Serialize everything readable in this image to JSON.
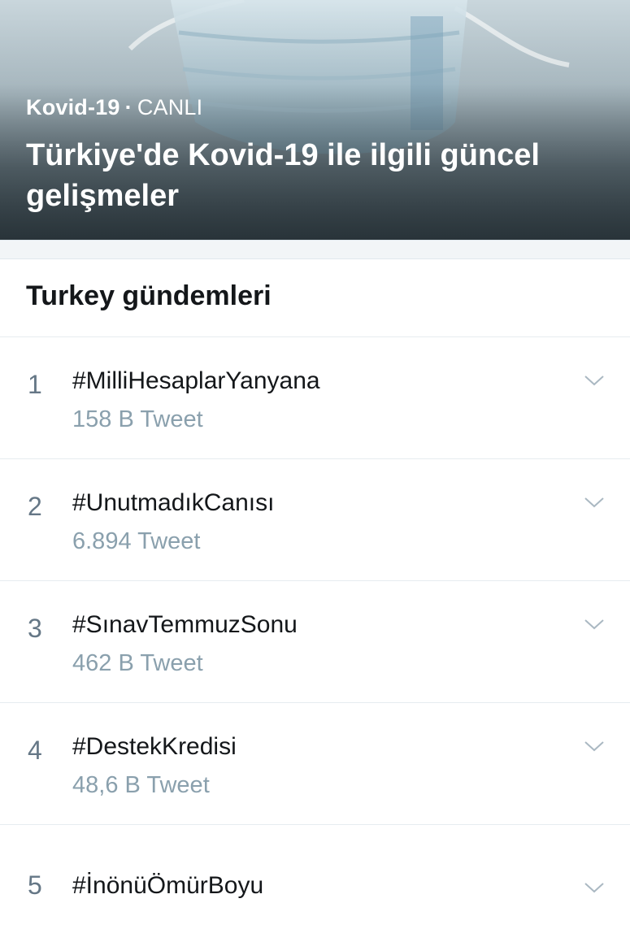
{
  "hero": {
    "category": "Kovid-19",
    "separator": "·",
    "live_label": "CANLI",
    "title": "Türkiye'de Kovid-19 ile ilgili güncel gelişmeler"
  },
  "section": {
    "title": "Turkey gündemleri"
  },
  "trends": [
    {
      "rank": "1",
      "tag": "#MilliHesaplarYanyana",
      "count": "158 B Tweet"
    },
    {
      "rank": "2",
      "tag": "#UnutmadıkCanısı",
      "count": "6.894 Tweet"
    },
    {
      "rank": "3",
      "tag": "#SınavTemmuzSonu",
      "count": "462 B Tweet"
    },
    {
      "rank": "4",
      "tag": "#DestekKredisi",
      "count": "48,6 B Tweet"
    },
    {
      "rank": "5",
      "tag": "#İnönüÖmürBoyu",
      "count": ""
    }
  ],
  "icons": {
    "more": "chevron-down-icon"
  },
  "colors": {
    "text_primary": "#14171a",
    "text_secondary": "#8aa0ad",
    "rank": "#657786",
    "divider": "#e6ecf0"
  }
}
